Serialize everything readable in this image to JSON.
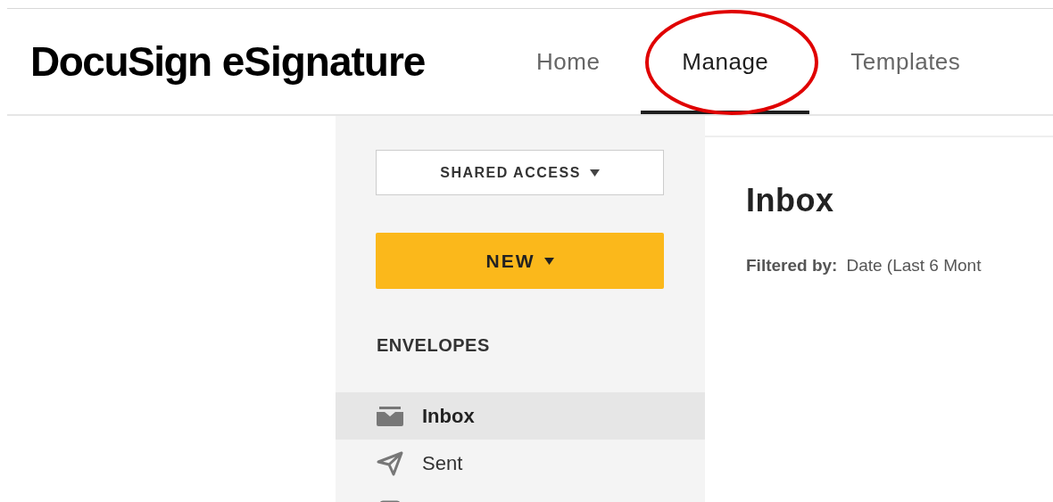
{
  "header": {
    "logo": "DocuSign",
    "logo_suffix": "eSignature",
    "nav": [
      {
        "label": "Home",
        "selected": false
      },
      {
        "label": "Manage",
        "selected": true,
        "circled": true
      },
      {
        "label": "Templates",
        "selected": false
      }
    ]
  },
  "sidebar": {
    "shared_access": "SHARED ACCESS",
    "new_button": "NEW",
    "section": "ENVELOPES",
    "items": [
      {
        "kind": "inbox",
        "label": "Inbox",
        "selected": true
      },
      {
        "kind": "sent",
        "label": "Sent",
        "selected": false
      },
      {
        "kind": "draft",
        "selected": false
      }
    ]
  },
  "main": {
    "title": "Inbox",
    "filter_label": "Filtered by:",
    "filter_value": "Date (Last 6 Mont"
  }
}
